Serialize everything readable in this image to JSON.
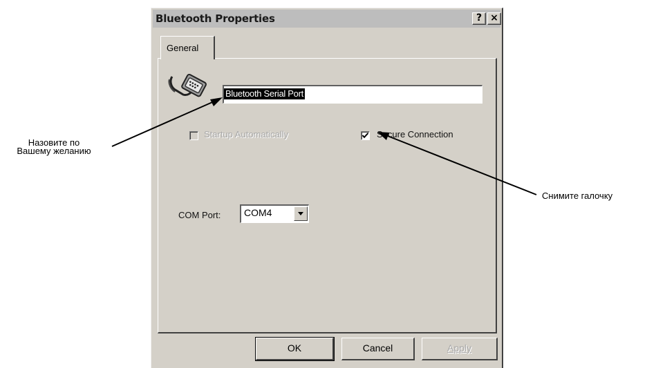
{
  "dialog": {
    "title": "Bluetooth Properties",
    "help_button": "?",
    "close_button": "×"
  },
  "tabs": [
    {
      "label": "General",
      "active": true
    }
  ],
  "general": {
    "icon": "serial-port-icon",
    "device_name": "Bluetooth Serial Port",
    "startup_automatically": {
      "label": "Startup Automatically",
      "checked": false,
      "enabled": false
    },
    "secure_connection": {
      "label": "Secure Connection",
      "checked": true,
      "enabled": true
    },
    "com_port": {
      "label": "COM Port:",
      "value": "COM4"
    }
  },
  "buttons": {
    "ok": "OK",
    "cancel": "Cancel",
    "apply": "Apply"
  },
  "annotations": {
    "rename": {
      "line1": "Назовите по",
      "line2": "Вашему желанию"
    },
    "uncheck": "Снимите галочку"
  }
}
